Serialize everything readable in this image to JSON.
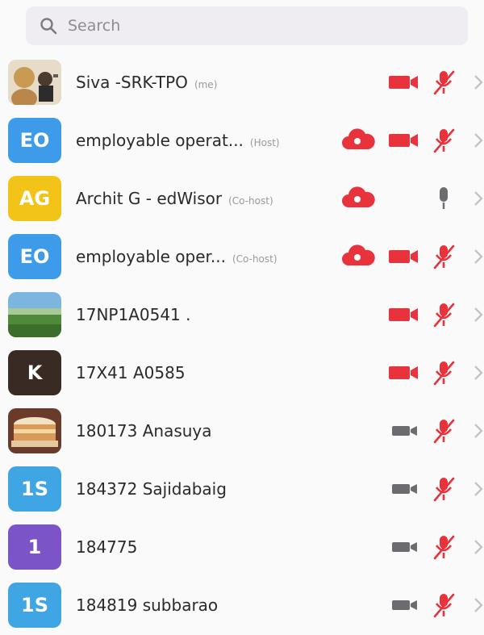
{
  "search": {
    "placeholder": "Search"
  },
  "colors": {
    "red": "#e8323c",
    "gray": "#6c6c70",
    "avatar_blue": "#3d9be9",
    "avatar_yellow": "#f2c417",
    "avatar_dark": "#3a2a24",
    "avatar_teal": "#3fa5e3",
    "avatar_purple": "#7b55c7"
  },
  "participants": [
    {
      "name": "Siva -SRK-TPO",
      "role": "(me)",
      "avatar": "photo-person",
      "cloud": false,
      "video": "on",
      "mic": "muted"
    },
    {
      "name": "employable operat...",
      "role": "(Host)",
      "avatar_text": "EO",
      "cloud": true,
      "video": "on",
      "mic": "muted"
    },
    {
      "name": "Archit G - edWisor",
      "role": "(Co-host)",
      "avatar_text": "AG",
      "cloud": true,
      "video": "none",
      "mic": "gray"
    },
    {
      "name": "employable oper...",
      "role": "(Co-host)",
      "avatar_text": "EO",
      "cloud": true,
      "video": "on",
      "mic": "muted"
    },
    {
      "name": "17NP1A0541 .",
      "role": "",
      "avatar": "photo-landscape",
      "cloud": false,
      "video": "on",
      "mic": "muted"
    },
    {
      "name": "17X41 A0585",
      "role": "",
      "avatar_text": "K",
      "cloud": false,
      "video": "on",
      "mic": "muted"
    },
    {
      "name": "180173 Anasuya",
      "role": "",
      "avatar": "photo-cake",
      "cloud": false,
      "video": "off",
      "mic": "muted"
    },
    {
      "name": "184372 Sajidabaig",
      "role": "",
      "avatar_text": "1S",
      "cloud": false,
      "video": "off",
      "mic": "muted"
    },
    {
      "name": "184775",
      "role": "",
      "avatar_text": "1",
      "cloud": false,
      "video": "off",
      "mic": "muted"
    },
    {
      "name": "184819 subbarao",
      "role": "",
      "avatar_text": "1S",
      "cloud": false,
      "video": "off",
      "mic": "muted"
    }
  ]
}
